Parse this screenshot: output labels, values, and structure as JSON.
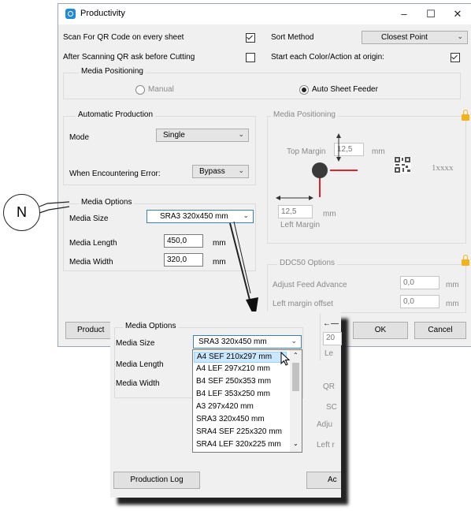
{
  "window": {
    "title": "Productivity",
    "minimize": "–",
    "maximize": "☐",
    "close": "✕"
  },
  "top": {
    "scan_qr_label": "Scan For QR Code on every sheet",
    "scan_qr_checked": true,
    "after_scan_label": "After Scanning QR ask before Cutting",
    "after_scan_checked": false,
    "sort_method_label": "Sort Method",
    "sort_method_value": "Closest Point",
    "start_each_label": "Start each Color/Action at origin:",
    "start_each_checked": true
  },
  "media_positioning_group": {
    "title": "Media Positioning",
    "manual_label": "Manual",
    "auto_label": "Auto Sheet Feeder",
    "selected": "Auto Sheet Feeder"
  },
  "automatic_production": {
    "title": "Automatic Production",
    "mode_label": "Mode",
    "mode_value": "Single",
    "error_label": "When Encountering Error:",
    "error_value": "Bypass"
  },
  "media_options": {
    "title": "Media Options",
    "size_label": "Media Size",
    "size_value": "SRA3 320x450 mm",
    "length_label": "Media Length",
    "length_value": "450,0",
    "width_label": "Media Width",
    "width_value": "320,0",
    "unit": "mm"
  },
  "media_positioning_panel": {
    "title": "Media Positioning",
    "top_margin_label": "Top Margin",
    "top_margin_value": "12,5",
    "left_margin_label": "Left Margin",
    "left_margin_value": "12,5",
    "unit": "mm",
    "qr_text": "1xxxx"
  },
  "ddc50": {
    "title": "DDC50 Options",
    "feed_label": "Adjust Feed Advance",
    "feed_value": "0,0",
    "offset_label": "Left margin offset",
    "offset_value": "0,0",
    "unit": "mm"
  },
  "buttons": {
    "production_log": "Production Log",
    "production_log_short": "Product",
    "ok": "OK",
    "cancel": "Cancel",
    "partial_ac": "Ac"
  },
  "callout": {
    "letter": "N"
  },
  "zoom": {
    "title": "Media Options",
    "size_label": "Media Size",
    "size_value": "SRA3 320x450 mm",
    "length_label": "Media Length",
    "width_label": "Media Width",
    "dropdown_options": [
      "A4 SEF 210x297 mm",
      "A4 LEF 297x210 mm",
      "B4 SEF 250x353 mm",
      "B4 LEF 353x250 mm",
      "A3 297x420 mm",
      "SRA3 320x450 mm",
      "SRA4 SEF 225x320 mm",
      "SRA4 LEF 320x225 mm"
    ],
    "highlighted_option": "A4 SEF 210x297 mm",
    "right_fragments": {
      "input": "20",
      "le": "Le",
      "qr": "QR",
      "sc": "SC",
      "adju": "Adju",
      "left": "Left r"
    }
  },
  "icons": [
    "productivity-app-icon",
    "lock-icon",
    "qr-code-icon",
    "mouse-cursor-icon",
    "callout-arrow-icon"
  ],
  "colors": {
    "accent": "#1f8ad8",
    "lock": "#f2b21b",
    "marker_red": "#e0202a",
    "dropdown_highlight": "#cce8ff"
  }
}
